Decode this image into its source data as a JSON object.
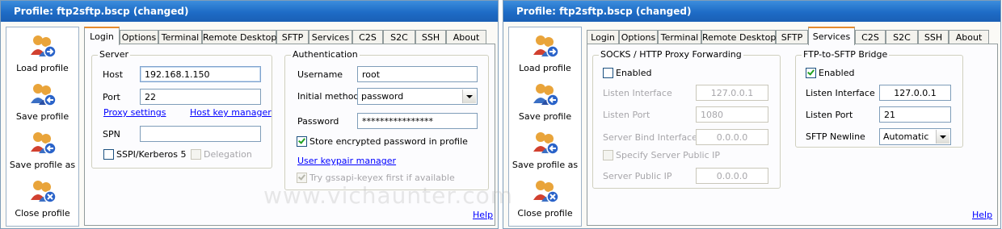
{
  "colors": {
    "title_bar": "#1e6cc6",
    "active_tab_accent": "#e68b2c",
    "link": "#0000ff"
  },
  "left_window": {
    "title": "Profile: ftp2sftp.bscp (changed)",
    "sidebar": [
      {
        "label": "Load profile",
        "icon": "load-profile-icon"
      },
      {
        "label": "Save profile",
        "icon": "save-profile-icon"
      },
      {
        "label": "Save profile as",
        "icon": "save-profile-as-icon"
      },
      {
        "label": "Close profile",
        "icon": "close-profile-icon"
      }
    ],
    "tabs": [
      "Login",
      "Options",
      "Terminal",
      "Remote Desktop",
      "SFTP",
      "Services",
      "C2S",
      "S2C",
      "SSH",
      "About"
    ],
    "active_tab": "Login",
    "server": {
      "title": "Server",
      "host_label": "Host",
      "host_value": "192.168.1.150",
      "port_label": "Port",
      "port_value": "22",
      "proxy_link": "Proxy settings",
      "hostkey_link": "Host key manager",
      "spn_label": "SPN",
      "spn_value": "",
      "sspi_label": "SSPI/Kerberos 5",
      "sspi_checked": false,
      "delegation_label": "Delegation",
      "delegation_checked": false
    },
    "auth": {
      "title": "Authentication",
      "username_label": "Username",
      "username_value": "root",
      "method_label": "Initial method",
      "method_value": "password",
      "password_label": "Password",
      "password_value": "****************",
      "store_label": "Store encrypted password in profile",
      "store_checked": true,
      "keypair_link": "User keypair manager",
      "gssapi_label": "Try gssapi-keyex first if available",
      "gssapi_checked": true
    },
    "help_link": "Help"
  },
  "right_window": {
    "title": "Profile: ftp2sftp.bscp (changed)",
    "sidebar": [
      {
        "label": "Load profile",
        "icon": "load-profile-icon"
      },
      {
        "label": "Save profile",
        "icon": "save-profile-icon"
      },
      {
        "label": "Save profile as",
        "icon": "save-profile-as-icon"
      },
      {
        "label": "Close profile",
        "icon": "close-profile-icon"
      }
    ],
    "tabs": [
      "Login",
      "Options",
      "Terminal",
      "Remote Desktop",
      "SFTP",
      "Services",
      "C2S",
      "S2C",
      "SSH",
      "About"
    ],
    "active_tab": "Services",
    "socks": {
      "title": "SOCKS / HTTP Proxy Forwarding",
      "enabled_label": "Enabled",
      "enabled_checked": false,
      "listen_interface_label": "Listen Interface",
      "listen_interface_value": "127.0.0.1",
      "listen_port_label": "Listen Port",
      "listen_port_value": "1080",
      "bind_label": "Server Bind Interface",
      "bind_value": "0.0.0.0",
      "specify_label": "Specify Server Public IP",
      "specify_checked": false,
      "public_ip_label": "Server Public IP",
      "public_ip_value": "0.0.0.0"
    },
    "ftp": {
      "title": "FTP-to-SFTP Bridge",
      "enabled_label": "Enabled",
      "enabled_checked": true,
      "listen_interface_label": "Listen Interface",
      "listen_interface_value": "127.0.0.1",
      "listen_port_label": "Listen Port",
      "listen_port_value": "21",
      "newline_label": "SFTP Newline",
      "newline_value": "Automatic"
    },
    "help_link": "Help"
  },
  "watermark": "www.vichaunter.com"
}
